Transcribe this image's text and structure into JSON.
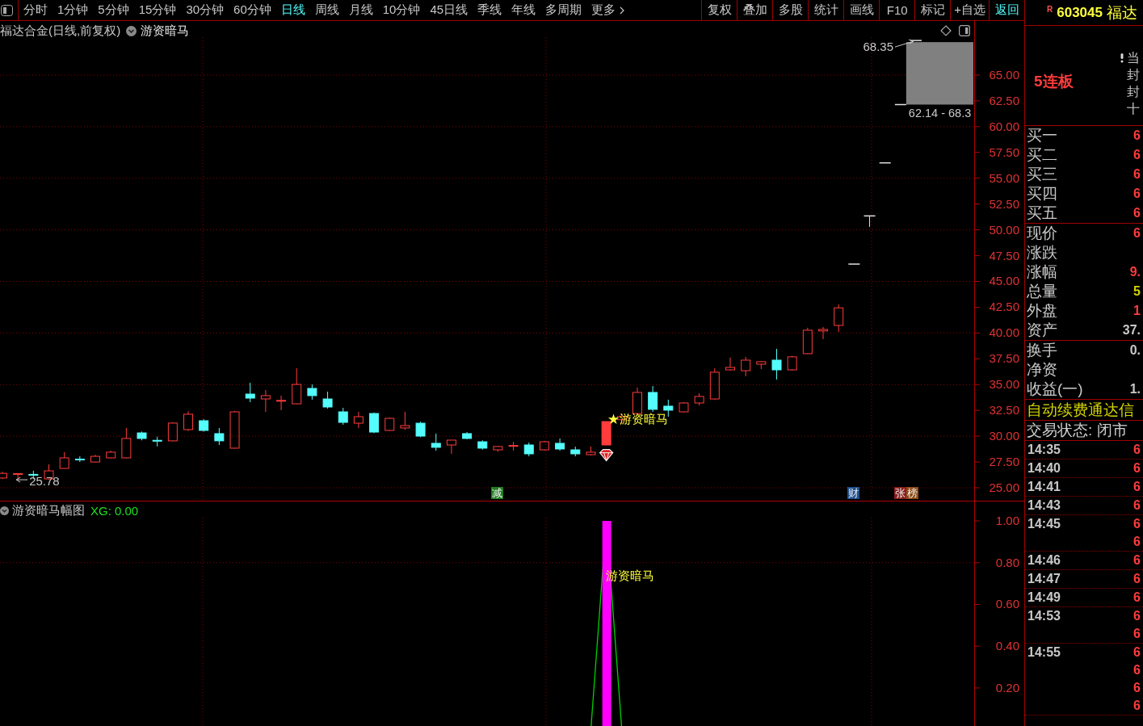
{
  "toolbar": {
    "periods": [
      {
        "label": "分时",
        "selected": false
      },
      {
        "label": "1分钟",
        "selected": false
      },
      {
        "label": "5分钟",
        "selected": false
      },
      {
        "label": "15分钟",
        "selected": false
      },
      {
        "label": "30分钟",
        "selected": false
      },
      {
        "label": "60分钟",
        "selected": false
      },
      {
        "label": "日线",
        "selected": true
      },
      {
        "label": "周线",
        "selected": false
      },
      {
        "label": "月线",
        "selected": false
      },
      {
        "label": "10分钟",
        "selected": false
      },
      {
        "label": "45日线",
        "selected": false
      },
      {
        "label": "季线",
        "selected": false
      },
      {
        "label": "年线",
        "selected": false
      },
      {
        "label": "多周期",
        "selected": false
      }
    ],
    "more": {
      "label": "更多"
    },
    "buttons": [
      {
        "label": "复权",
        "kind": "button"
      },
      {
        "label": "叠加",
        "kind": "button"
      },
      {
        "label": "多股",
        "kind": "button"
      },
      {
        "label": "统计",
        "kind": "button"
      },
      {
        "label": "画线",
        "kind": "button"
      },
      {
        "label": "F10",
        "kind": "button"
      },
      {
        "label": "标记",
        "kind": "button"
      },
      {
        "label": "+自选",
        "kind": "button"
      },
      {
        "label": "返回",
        "kind": "link"
      }
    ]
  },
  "main_chart": {
    "title": "福达合金(日线,前复权)",
    "indicator": "游资暗马",
    "price_axis": [
      "65.00",
      "62.50",
      "60.00",
      "57.50",
      "55.00",
      "52.50",
      "50.00",
      "47.50",
      "45.00",
      "42.50",
      "40.00",
      "37.50",
      "35.00",
      "32.50",
      "30.00",
      "27.50",
      "25.00"
    ],
    "range_label": "62.14 - 68.3",
    "high_label": "68.35",
    "low_label": "25.78",
    "signal_label": "★游资暗马",
    "events": [
      {
        "tags": [
          {
            "text": "减",
            "color": "#1e7d1e"
          }
        ]
      },
      {
        "tags": [
          {
            "text": "财",
            "color": "#1f4f8c"
          }
        ]
      },
      {
        "tags": [
          {
            "text": "张",
            "color": "#8c1c1c"
          },
          {
            "text": "榜",
            "color": "#8c4a14"
          }
        ]
      }
    ]
  },
  "sub_chart": {
    "title": "游资暗马幅图",
    "reading": "XG: 0.00",
    "axis": [
      "1.00",
      "0.80",
      "0.60",
      "0.40",
      "0.20"
    ],
    "signal_label": "游资暗马"
  },
  "quote_panel": {
    "market_mark": "R",
    "code": "603045",
    "name": "福达",
    "streak": "5连板",
    "notes": [
      "当",
      "封",
      "封",
      "十"
    ],
    "order_book": [
      {
        "label": "买一",
        "value": "6"
      },
      {
        "label": "买二",
        "value": "6"
      },
      {
        "label": "买三",
        "value": "6"
      },
      {
        "label": "买四",
        "value": "6"
      },
      {
        "label": "买五",
        "value": "6"
      }
    ],
    "quote": [
      {
        "label": "现价",
        "value": "6",
        "color": "#ff3c3c"
      },
      {
        "label": "涨跌"
      },
      {
        "label": "涨幅",
        "value": "9.",
        "color": "#ff3c3c"
      },
      {
        "label": "总量",
        "value": "5",
        "color": "#d2d200"
      },
      {
        "label": "外盘",
        "value": "1",
        "color": "#ff3c3c"
      },
      {
        "label": "资产",
        "value": "37.",
        "color": "#c8c8c8"
      }
    ],
    "stats": [
      {
        "label": "换手",
        "value": "0.",
        "color": "#c8c8c8"
      },
      {
        "label": "净资"
      },
      {
        "label": "收益(一)",
        "value": "1.",
        "color": "#c8c8c8"
      }
    ],
    "notice": "自动续费通达信",
    "trade_status": "交易状态: 闭市",
    "ticks": [
      {
        "time": "14:35",
        "prices": [
          "6"
        ]
      },
      {
        "time": "14:40",
        "prices": [
          "6"
        ]
      },
      {
        "time": "14:41",
        "prices": [
          "6"
        ]
      },
      {
        "time": "14:43",
        "prices": [
          "6"
        ]
      },
      {
        "time": "14:45",
        "prices": [
          "6",
          "6"
        ]
      },
      {
        "time": "14:46",
        "prices": [
          "6"
        ]
      },
      {
        "time": "14:47",
        "prices": [
          "6"
        ]
      },
      {
        "time": "14:49",
        "prices": [
          "6"
        ]
      },
      {
        "time": "14:53",
        "prices": [
          "6",
          "6"
        ]
      },
      {
        "time": "14:55",
        "prices": [
          "6",
          "6",
          "6",
          "6"
        ]
      }
    ]
  }
}
